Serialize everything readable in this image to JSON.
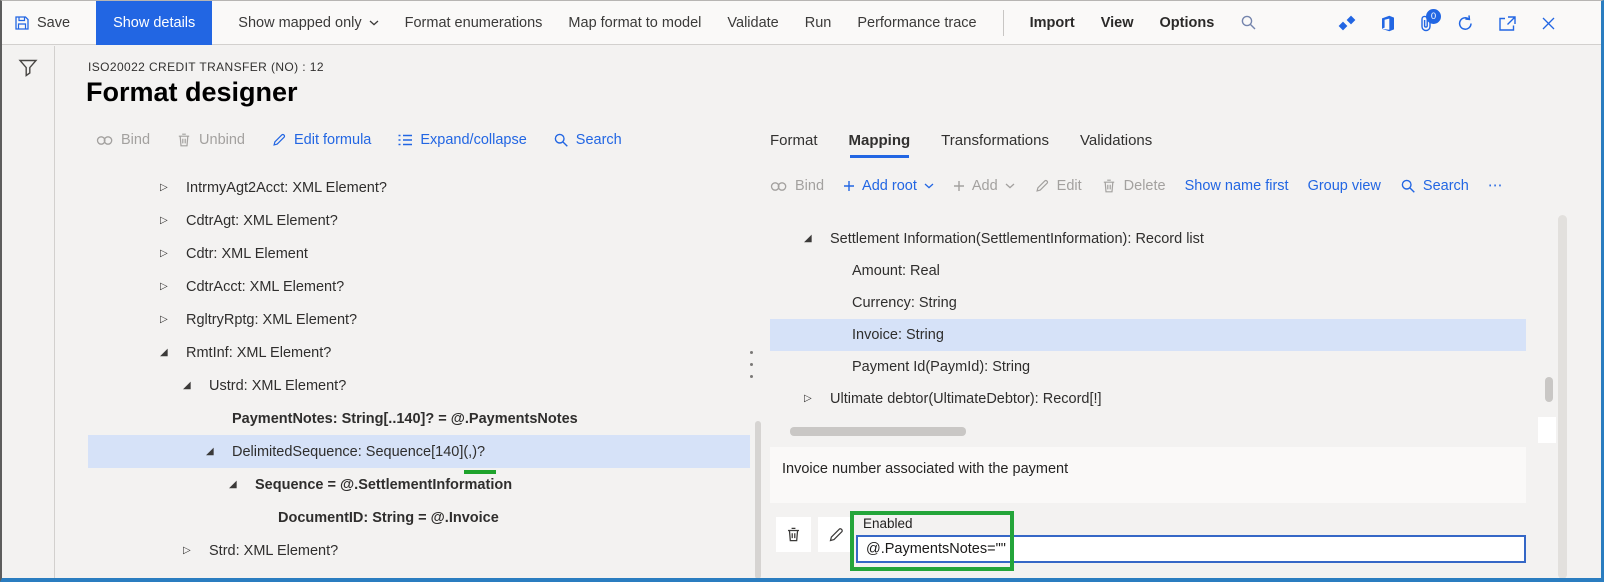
{
  "app_bar": {
    "save_label": "Save",
    "show_details_label": "Show details",
    "show_mapped_only_label": "Show mapped only",
    "format_enumerations_label": "Format enumerations",
    "map_format_to_model_label": "Map format to model",
    "validate_label": "Validate",
    "run_label": "Run",
    "performance_trace_label": "Performance trace",
    "import_label": "Import",
    "view_label": "View",
    "options_label": "Options",
    "attachments_badge": "0"
  },
  "page_header": {
    "record_caption": "ISO20022 CREDIT TRANSFER (NO) : 12",
    "title": "Format designer"
  },
  "format_panel": {
    "toolbar": {
      "bind": "Bind",
      "unbind": "Unbind",
      "edit_formula": "Edit formula",
      "expand_collapse": "Expand/collapse",
      "search": "Search"
    },
    "tree": [
      {
        "label": "IntrmyAgt2Acct: XML Element?",
        "state": "collapsed",
        "level": 0
      },
      {
        "label": "CdtrAgt: XML Element?",
        "state": "collapsed",
        "level": 0
      },
      {
        "label": "Cdtr: XML Element",
        "state": "collapsed",
        "level": 0
      },
      {
        "label": "CdtrAcct: XML Element?",
        "state": "collapsed",
        "level": 0
      },
      {
        "label": "RgltryRptg: XML Element?",
        "state": "collapsed",
        "level": 0
      },
      {
        "label": "RmtInf: XML Element?",
        "state": "expanded",
        "level": 0
      },
      {
        "label": "Ustrd: XML Element?",
        "state": "expanded",
        "level": 1
      },
      {
        "label": "PaymentNotes: String[..140]? = @.PaymentsNotes",
        "state": "leaf",
        "level": 2,
        "bound": true
      },
      {
        "label": "DelimitedSequence: Sequence[140](,)?",
        "state": "expanded",
        "level": 2,
        "selected": true
      },
      {
        "label": "Sequence = @.SettlementInformation",
        "state": "expanded",
        "level": 3,
        "bound": true
      },
      {
        "label": "DocumentID: String = @.Invoice",
        "state": "leaf",
        "level": 4,
        "bound": true
      },
      {
        "label": "Strd: XML Element?",
        "state": "collapsed",
        "level": 1
      }
    ]
  },
  "mapping_panel": {
    "tabs": [
      "Format",
      "Mapping",
      "Transformations",
      "Validations"
    ],
    "active_tab": "Mapping",
    "toolbar": {
      "bind": "Bind",
      "add_root": "Add root",
      "add": "Add",
      "edit": "Edit",
      "delete": "Delete",
      "show_name_first": "Show name first",
      "group_view": "Group view",
      "search": "Search",
      "more": "⋯"
    },
    "tree": [
      {
        "label": "Settlement Information(SettlementInformation): Record list",
        "state": "expanded",
        "level": 0
      },
      {
        "label": "Amount: Real",
        "state": "leaf",
        "level": 1
      },
      {
        "label": "Currency: String",
        "state": "leaf",
        "level": 1
      },
      {
        "label": "Invoice: String",
        "state": "leaf",
        "level": 1,
        "selected": true
      },
      {
        "label": "Payment Id(PaymId): String",
        "state": "leaf",
        "level": 1
      },
      {
        "label": "Ultimate debtor(UltimateDebtor): Record[!]",
        "state": "collapsed",
        "level": 0
      }
    ],
    "description": "Invoice number associated with the payment",
    "formula_field": {
      "label": "Enabled",
      "value": "@.PaymentsNotes=\"\""
    }
  },
  "colors": {
    "accent_blue": "#2266E3",
    "selection_blue": "#d6e2f8",
    "annotation_green": "#24a53a",
    "frame_blue": "#2a7dc0",
    "disabled_grey": "#a3a19f"
  }
}
